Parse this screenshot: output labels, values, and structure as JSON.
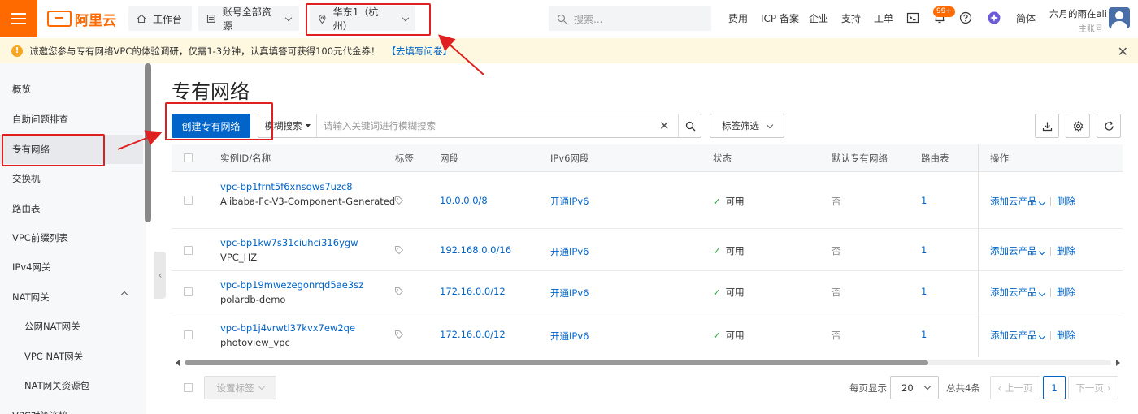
{
  "topbar": {
    "logo_text": "阿里云",
    "workbench_label": "工作台",
    "account_scope_label": "账号全部资源",
    "region_label": "华东1（杭州）",
    "search_placeholder": "搜索...",
    "links": [
      "费用",
      "ICP 备案",
      "企业",
      "支持",
      "工单"
    ],
    "notification_badge": "99+",
    "language_label": "简体",
    "user_name": "六月的雨在ali",
    "user_role": "主账号",
    "accent_color": "#ff6a00"
  },
  "notice": {
    "text": "诚邀您参与专有网络VPC的体验调研，仅需1-3分钟，认真填答可获得100元代金券！",
    "link_text": "【去填写问卷】"
  },
  "sidebar": {
    "items": [
      {
        "label": "概览"
      },
      {
        "label": "自助问题排查"
      },
      {
        "label": "专有网络"
      },
      {
        "label": "交换机"
      },
      {
        "label": "路由表"
      },
      {
        "label": "VPC前缀列表"
      },
      {
        "label": "IPv4网关"
      },
      {
        "label": "NAT网关"
      },
      {
        "label": "公网NAT网关"
      },
      {
        "label": "VPC NAT网关"
      },
      {
        "label": "NAT网关资源包"
      },
      {
        "label": "VPC对等连接"
      }
    ]
  },
  "main": {
    "title": "专有网络",
    "create_button": "创建专有网络",
    "filter_type": "模糊搜索",
    "filter_placeholder": "请输入关键词进行模糊搜索",
    "tag_filter_label": "标签筛选",
    "columns": [
      "实例ID/名称",
      "标签",
      "网段",
      "IPv6网段",
      "状态",
      "默认专有网络",
      "路由表",
      "操作"
    ],
    "rows": [
      {
        "id": "vpc-bp1frnt5f6xnsqws7uzc8",
        "name": "Alibaba-Fc-V3-Component-Generated",
        "cidr": "10.0.0.0/8",
        "ipv6": "开通IPv6",
        "status": "可用",
        "default": "否",
        "route_tables": "1",
        "action_add": "添加云产品",
        "action_delete": "删除"
      },
      {
        "id": "vpc-bp1kw7s31ciuhci316ygw",
        "name": "VPC_HZ",
        "cidr": "192.168.0.0/16",
        "ipv6": "开通IPv6",
        "status": "可用",
        "default": "否",
        "route_tables": "1",
        "action_add": "添加云产品",
        "action_delete": "删除"
      },
      {
        "id": "vpc-bp19mwezegonrqd5ae3sz",
        "name": "polardb-demo",
        "cidr": "172.16.0.0/12",
        "ipv6": "开通IPv6",
        "status": "可用",
        "default": "否",
        "route_tables": "1",
        "action_add": "添加云产品",
        "action_delete": "删除"
      },
      {
        "id": "vpc-bp1j4vrwtl37kvx7ew2qe",
        "name": "photoview_vpc",
        "cidr": "172.16.0.0/12",
        "ipv6": "开通IPv6",
        "status": "可用",
        "default": "否",
        "route_tables": "1",
        "action_add": "添加云产品",
        "action_delete": "删除"
      }
    ],
    "footer": {
      "set_tag_button": "设置标签",
      "per_page_label": "每页显示",
      "per_page_value": "20",
      "total_label": "总共4条",
      "prev_label": "上一页",
      "current_page": "1",
      "next_label": "下一页"
    }
  }
}
